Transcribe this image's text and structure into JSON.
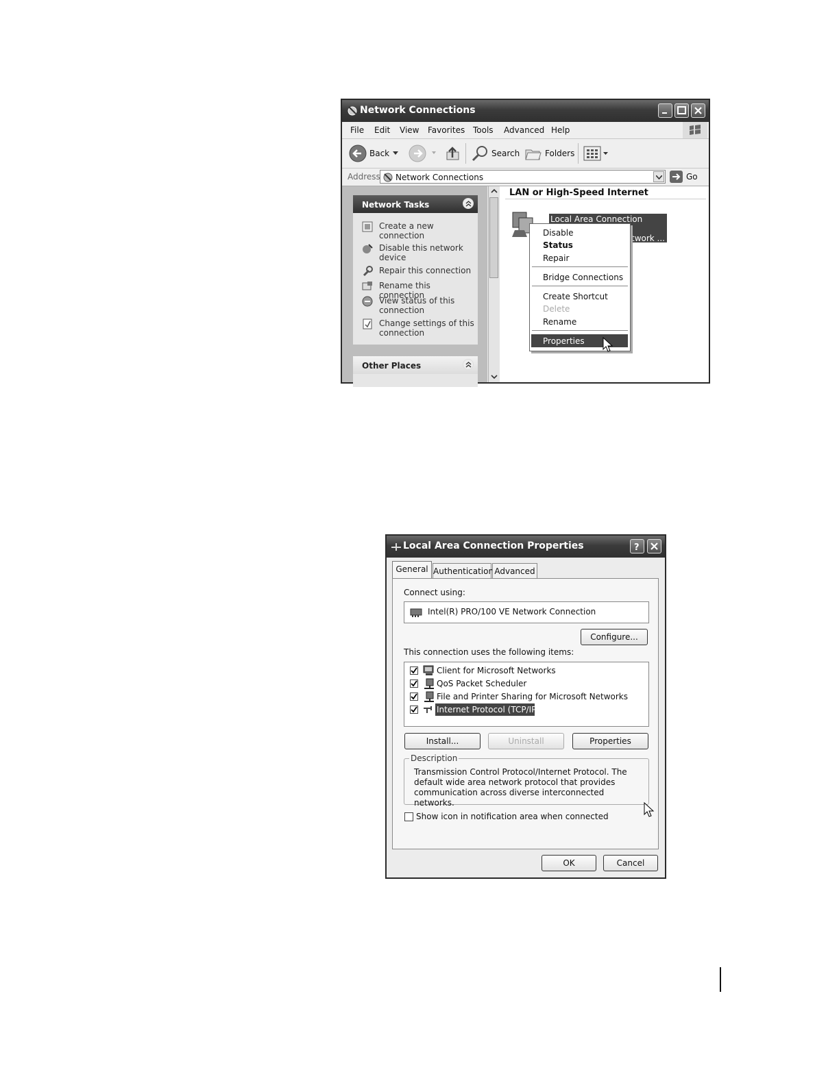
{
  "network_window": {
    "title": "Network Connections",
    "menu": [
      "File",
      "Edit",
      "View",
      "Favorites",
      "Tools",
      "Advanced",
      "Help"
    ],
    "toolbar": {
      "back": "Back",
      "search": "Search",
      "folders": "Folders"
    },
    "address": {
      "label": "Address",
      "value": "Network Connections",
      "go": "Go"
    },
    "network_tasks": {
      "title": "Network Tasks",
      "items": [
        "Create a new connection",
        "Disable this network device",
        "Repair this connection",
        "Rename this connection",
        "View status of this connection",
        "Change settings of this connection"
      ]
    },
    "other_places": {
      "title": "Other Places"
    },
    "group_header": "LAN or High-Speed Internet",
    "connection": {
      "name": "Local Area Connection",
      "subtitle": "etwork ..."
    },
    "context_menu": {
      "items": [
        "Disable",
        "Status",
        "Repair",
        "Bridge Connections",
        "Create Shortcut",
        "Delete",
        "Rename",
        "Properties"
      ],
      "highlighted": "Properties"
    }
  },
  "properties_dialog": {
    "title": "Local Area Connection Properties",
    "tabs": [
      "General",
      "Authentication",
      "Advanced"
    ],
    "connect_using_label": "Connect using:",
    "adapter": "Intel(R) PRO/100 VE Network Connection",
    "configure_button": "Configure...",
    "items_label": "This connection uses the following items:",
    "items": [
      {
        "label": "Client for Microsoft Networks",
        "checked": true
      },
      {
        "label": "QoS Packet Scheduler",
        "checked": true
      },
      {
        "label": "File and Printer Sharing for Microsoft Networks",
        "checked": true
      },
      {
        "label": "Internet Protocol (TCP/IP)",
        "checked": true,
        "selected": true
      }
    ],
    "install_button": "Install...",
    "uninstall_button": "Uninstall",
    "properties_button": "Properties",
    "description_label": "Description",
    "description_text": "Transmission Control Protocol/Internet Protocol. The default wide area network protocol that provides communication across diverse interconnected networks.",
    "show_icon_label": "Show icon in notification area when connected",
    "show_icon_checked": false,
    "ok_button": "OK",
    "cancel_button": "Cancel"
  }
}
